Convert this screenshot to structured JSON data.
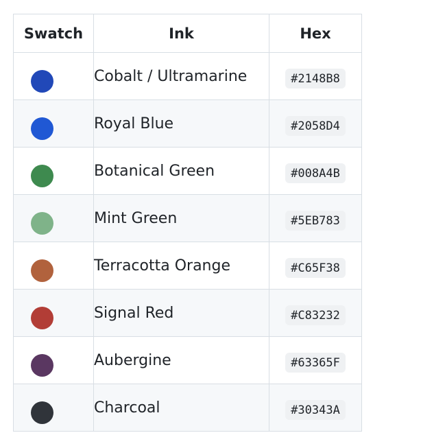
{
  "table": {
    "headers": {
      "swatch": "Swatch",
      "ink": "Ink",
      "hex": "Hex"
    },
    "rows": [
      {
        "ink": "Cobalt / Ultramarine",
        "hex": "#2148B8",
        "color": "#2148B8",
        "swatch_icon": "color-swatch-dot"
      },
      {
        "ink": "Royal Blue",
        "hex": "#2058D4",
        "color": "#2058D4",
        "swatch_icon": "color-swatch-dot"
      },
      {
        "ink": "Botanical Green",
        "hex": "#008A4B",
        "color": "#3E8A4F",
        "swatch_icon": "color-swatch-dot"
      },
      {
        "ink": "Mint Green",
        "hex": "#5EB783",
        "color": "#7FB389",
        "swatch_icon": "color-swatch-dot"
      },
      {
        "ink": "Terracotta Orange",
        "hex": "#C65F38",
        "color": "#B1623D",
        "swatch_icon": "color-swatch-dot"
      },
      {
        "ink": "Signal Red",
        "hex": "#C83232",
        "color": "#B23D36",
        "swatch_icon": "color-swatch-dot"
      },
      {
        "ink": "Aubergine",
        "hex": "#63365F",
        "color": "#5A3761",
        "swatch_icon": "color-swatch-dot"
      },
      {
        "ink": "Charcoal",
        "hex": "#30343A",
        "color": "#30343A",
        "swatch_icon": "color-swatch-dot"
      }
    ]
  }
}
